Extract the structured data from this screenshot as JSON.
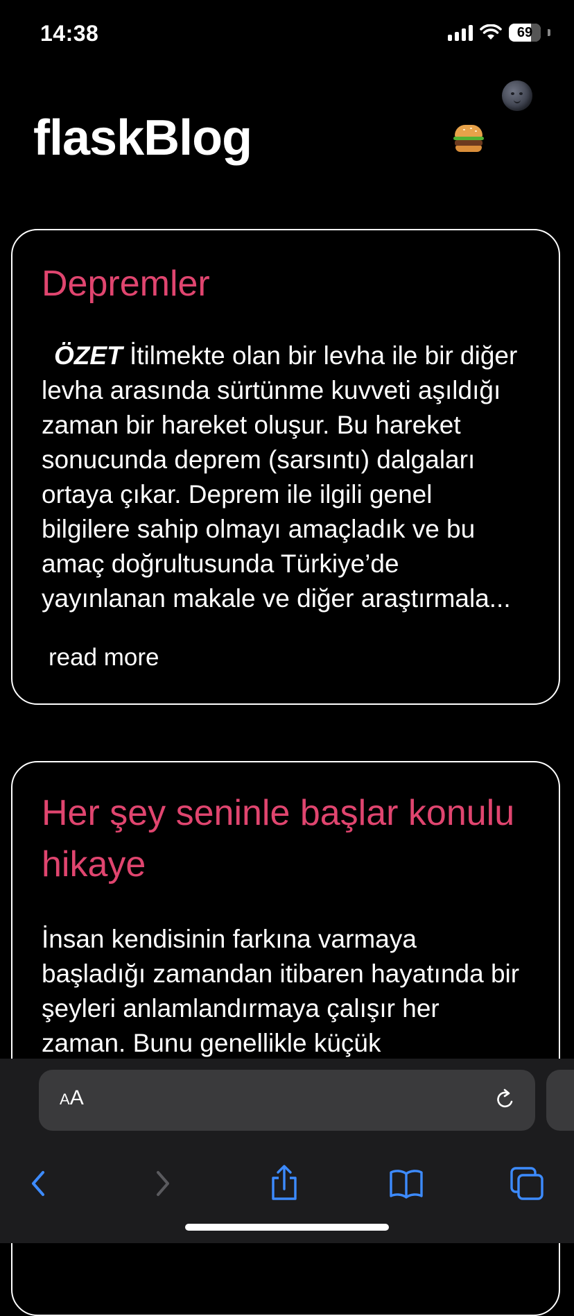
{
  "status_bar": {
    "time": "14:38",
    "battery": "69"
  },
  "header": {
    "site_title": "flaskBlog",
    "theme_toggle_icon": "moon-face-icon",
    "menu_icon": "hamburger-emoji-icon"
  },
  "posts": [
    {
      "title": "Depremler",
      "excerpt_lead": "ÖZET",
      "excerpt": "İtilmekte olan bir levha ile bir diğer levha arasında sürtünme kuvveti aşıldığı zaman bir hareket oluşur. Bu hareket sonucunda deprem (sarsıntı) dalgaları ortaya çıkar. Deprem ile ilgili genel bilgilere sahip olmayı amaçladık ve bu amaç doğrultusunda Türkiye’de yayınlanan makale ve diğer araştırmala...",
      "read_more": "read more"
    },
    {
      "title": "Her şey seninle başlar konulu hikaye",
      "excerpt": "İnsan kendisinin farkına varmaya başladığı zamandan itibaren hayatında bir şeyleri anlamlandırmaya çalışır her zaman. Bunu genellikle küçük"
    }
  ],
  "browser": {
    "aa_small": "A",
    "aa_large": "A",
    "icons": [
      "chevron-left-icon",
      "chevron-right-icon",
      "share-icon",
      "book-icon",
      "tabs-icon",
      "reload-icon"
    ]
  },
  "colors": {
    "background": "#000000",
    "post_title": "#e0456f",
    "toolbar_bg": "#1c1c1e",
    "toolbar_icon": "#3d8bff"
  }
}
